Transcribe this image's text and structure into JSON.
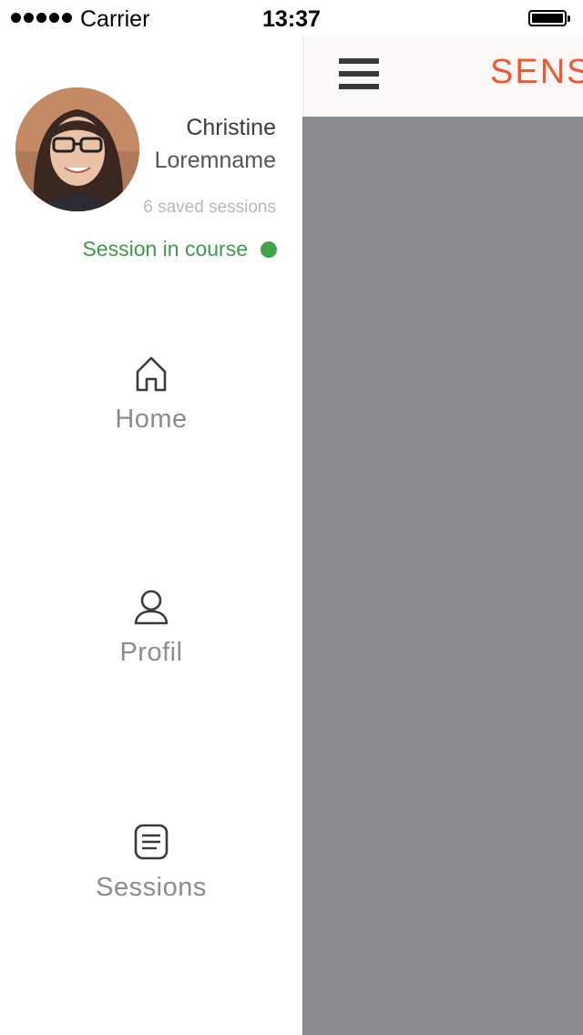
{
  "status_bar": {
    "carrier": "Carrier",
    "time": "13:37",
    "signal_dots": 5
  },
  "header": {
    "title": "SENS",
    "menu_icon": "hamburger-icon",
    "title_color": "#ee5a2f"
  },
  "drawer": {
    "user": {
      "first_name": "Christine",
      "last_name": "Loremname",
      "saved_sessions": "6 saved sessions",
      "session_status": "Session in course",
      "status_color": "#3da64b"
    },
    "nav": [
      {
        "label": "Home",
        "icon": "home-icon"
      },
      {
        "label": "Profil",
        "icon": "user-icon"
      },
      {
        "label": "Sessions",
        "icon": "list-icon"
      }
    ]
  },
  "overlay_color": "#8a8b8f"
}
